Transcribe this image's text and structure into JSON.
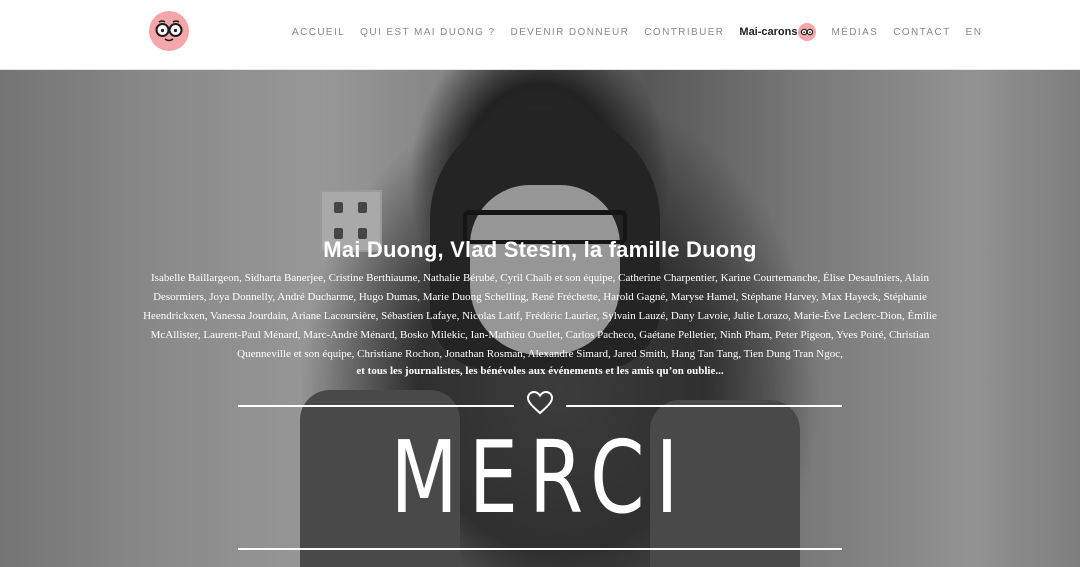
{
  "header": {
    "nav": [
      {
        "label": "ACCUEIL"
      },
      {
        "label": "QUI EST MAI DUONG ?"
      },
      {
        "label": "DEVENIR DONNEUR"
      },
      {
        "label": "CONTRIBUER"
      },
      {
        "label": "Mai-carons"
      },
      {
        "label": "MÉDIAS"
      },
      {
        "label": "CONTACT"
      },
      {
        "label": "EN"
      }
    ]
  },
  "hero": {
    "title": "Mai Duong, Vlad Stesin, la famille Duong",
    "names_lines": [
      "Isabelle Baillargeon, Sidharta Banerjee, Cristine Berthiaume, Nathalie Bérubé, Cyril Chaib et son équipe, Catherine Charpentier, Karine Courtemanche, Élise Desaulniers, Alain",
      "Desormiers, Joya Donnelly, André Ducharme, Hugo Dumas, Marie Duong Schelling, René Fréchette, Harold Gagné, Maryse Hamel, Stéphane Harvey, Max Hayeck, Stéphanie",
      "Heendrickxen, Vanessa Jourdain, Ariane Lacoursière, Sébastien Lafaye, Nicolas Latif, Frédéric Laurier, Sylvain Lauzé, Dany Lavoie, Julie Lorazo, Marie-Ève Leclerc-Dion, Émilie",
      "McAllister, Laurent-Paul Ménard, Marc-André Ménard, Bosko Milekic, Ian-Mathieu Ouellet, Carlos Pacheco, Gaétane Pelletier, Ninh Pham, Peter Pigeon, Yves Poiré, Christian",
      "Quenneville et son équipe, Christiane Rochon, Jonathan Rosman, Alexandre Simard, Jared Smith, Hang Tan Tang, Tien Dung Tran Ngoc,"
    ],
    "tail": "et tous les journalistes, les bénévoles aux événements et les amis qu’on oublie...",
    "big_word": "MERCI"
  },
  "colors": {
    "logo_bg": "#f4a6a9",
    "nav_text": "#8a8a8a",
    "hero_text": "#ffffff"
  },
  "icons": {
    "logo": "face-with-glasses-logo",
    "nav_badge": "face-with-glasses-icon",
    "heart": "heart-outline-icon"
  }
}
